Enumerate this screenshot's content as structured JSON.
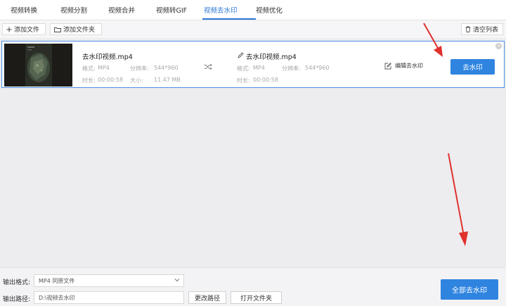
{
  "tabs": [
    {
      "label": "视频转换"
    },
    {
      "label": "视频分割"
    },
    {
      "label": "视频合并"
    },
    {
      "label": "视频转GIF"
    },
    {
      "label": "视频去水印",
      "active": true
    },
    {
      "label": "视频优化"
    }
  ],
  "toolbar": {
    "add_file": "添加文件",
    "add_folder": "添加文件夹",
    "clear_list": "清空列表"
  },
  "file": {
    "name": "去水印视频.mp4",
    "format_label": "格式:",
    "format": "MP4",
    "resolution_label": "分辨率:",
    "resolution": "544*960",
    "duration_label": "时长:",
    "duration": "00:00:58",
    "size_label": "大小:",
    "size": "11.47 MB",
    "out_name": "去水印视频.mp4",
    "out_format_label": "格式:",
    "out_format": "MP4",
    "out_resolution_label": "分辨率:",
    "out_resolution": "544*960",
    "out_duration_label": "时长:",
    "out_duration": "00:00:58",
    "edit_watermark": "编辑去水印",
    "remove_button": "去水印"
  },
  "bottom": {
    "format_label": "输出格式:",
    "format_value": "MP4  同原文件",
    "path_label": "输出路径:",
    "path_value": "D:\\视频去水印",
    "change_path": "更改路径",
    "open_folder": "打开文件夹",
    "remove_all": "全部去水印"
  },
  "colors": {
    "accent": "#2f84e0",
    "annotation_arrow": "#e0302c"
  },
  "icons": [
    "plus-icon",
    "folder-icon",
    "trash-icon",
    "close-icon",
    "pencil-icon",
    "shuffle-icon",
    "edit-icon",
    "chevron-down-icon"
  ]
}
